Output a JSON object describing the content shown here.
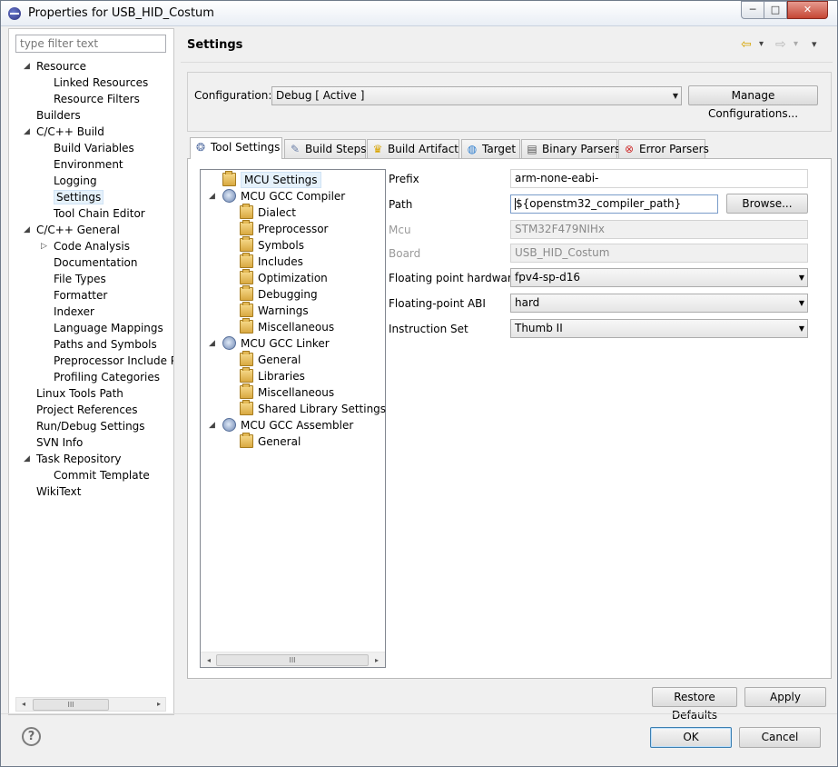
{
  "window": {
    "title": "Properties for USB_HID_Costum",
    "controls": [
      "─",
      "□",
      "✕"
    ]
  },
  "filter": {
    "placeholder": "type filter text"
  },
  "nav": [
    {
      "label": "Resource",
      "level": 0,
      "toggle": "◢"
    },
    {
      "label": "Linked Resources",
      "level": 1
    },
    {
      "label": "Resource Filters",
      "level": 1
    },
    {
      "label": "Builders",
      "level": 0
    },
    {
      "label": "C/C++ Build",
      "level": 0,
      "toggle": "◢"
    },
    {
      "label": "Build Variables",
      "level": 1
    },
    {
      "label": "Environment",
      "level": 1
    },
    {
      "label": "Logging",
      "level": 1
    },
    {
      "label": "Settings",
      "level": 1,
      "selected": true
    },
    {
      "label": "Tool Chain Editor",
      "level": 1
    },
    {
      "label": "C/C++ General",
      "level": 0,
      "toggle": "◢"
    },
    {
      "label": "Code Analysis",
      "level": 1,
      "toggle": "▷"
    },
    {
      "label": "Documentation",
      "level": 1
    },
    {
      "label": "File Types",
      "level": 1
    },
    {
      "label": "Formatter",
      "level": 1
    },
    {
      "label": "Indexer",
      "level": 1
    },
    {
      "label": "Language Mappings",
      "level": 1
    },
    {
      "label": "Paths and Symbols",
      "level": 1
    },
    {
      "label": "Preprocessor Include Pa",
      "level": 1
    },
    {
      "label": "Profiling Categories",
      "level": 1
    },
    {
      "label": "Linux Tools Path",
      "level": 0
    },
    {
      "label": "Project References",
      "level": 0
    },
    {
      "label": "Run/Debug Settings",
      "level": 0
    },
    {
      "label": "SVN Info",
      "level": 0
    },
    {
      "label": "Task Repository",
      "level": 0,
      "toggle": "◢"
    },
    {
      "label": "Commit Template",
      "level": 1
    },
    {
      "label": "WikiText",
      "level": 0
    }
  ],
  "header": {
    "title": "Settings",
    "back_icon": "⇦",
    "forward_icon": "⇨",
    "menu_icon": "▾"
  },
  "configuration": {
    "label": "Configuration:",
    "value": "Debug  [ Active ]",
    "manage_label": "Manage Configurations..."
  },
  "tabs": [
    {
      "label": "Tool Settings",
      "icon": "❂",
      "icon_color": "#5a73a5",
      "active": true
    },
    {
      "label": "Build Steps",
      "icon": "✎",
      "icon_color": "#6b7fa8"
    },
    {
      "label": "Build Artifact",
      "icon": "♛",
      "icon_color": "#d9a400"
    },
    {
      "label": "Target",
      "icon": "◍",
      "icon_color": "#2f7fd0"
    },
    {
      "label": "Binary Parsers",
      "icon": "▤",
      "icon_color": "#555555"
    },
    {
      "label": "Error Parsers",
      "icon": "⊗",
      "icon_color": "#d03030"
    }
  ],
  "tool_tree": [
    {
      "label": "MCU Settings",
      "level": 0,
      "icon": "folder",
      "selected": true
    },
    {
      "label": "MCU GCC Compiler",
      "level": 0,
      "icon": "tool",
      "toggle": "◢"
    },
    {
      "label": "Dialect",
      "level": 1,
      "icon": "folder"
    },
    {
      "label": "Preprocessor",
      "level": 1,
      "icon": "folder"
    },
    {
      "label": "Symbols",
      "level": 1,
      "icon": "folder"
    },
    {
      "label": "Includes",
      "level": 1,
      "icon": "folder"
    },
    {
      "label": "Optimization",
      "level": 1,
      "icon": "folder"
    },
    {
      "label": "Debugging",
      "level": 1,
      "icon": "folder"
    },
    {
      "label": "Warnings",
      "level": 1,
      "icon": "folder"
    },
    {
      "label": "Miscellaneous",
      "level": 1,
      "icon": "folder"
    },
    {
      "label": "MCU GCC Linker",
      "level": 0,
      "icon": "tool",
      "toggle": "◢"
    },
    {
      "label": "General",
      "level": 1,
      "icon": "folder"
    },
    {
      "label": "Libraries",
      "level": 1,
      "icon": "folder"
    },
    {
      "label": "Miscellaneous",
      "level": 1,
      "icon": "folder"
    },
    {
      "label": "Shared Library Settings",
      "level": 1,
      "icon": "folder"
    },
    {
      "label": "MCU GCC Assembler",
      "level": 0,
      "icon": "tool",
      "toggle": "◢"
    },
    {
      "label": "General",
      "level": 1,
      "icon": "folder"
    }
  ],
  "props": {
    "prefix_label": "Prefix",
    "prefix_value": "arm-none-eabi-",
    "path_label": "Path",
    "path_value": "${openstm32_compiler_path}",
    "browse_label": "Browse...",
    "mcu_label": "Mcu",
    "mcu_value": "STM32F479NIHx",
    "board_label": "Board",
    "board_value": "USB_HID_Costum",
    "fph_label": "Floating point hardware",
    "fph_value": "fpv4-sp-d16",
    "abi_label": "Floating-point ABI",
    "abi_value": "hard",
    "iset_label": "Instruction Set",
    "iset_value": "Thumb II"
  },
  "buttons": {
    "restore_defaults": "Restore Defaults",
    "apply": "Apply",
    "ok": "OK",
    "cancel": "Cancel",
    "help": "?"
  },
  "scroll": {
    "left": "◂",
    "right": "▸",
    "grip": "III"
  }
}
